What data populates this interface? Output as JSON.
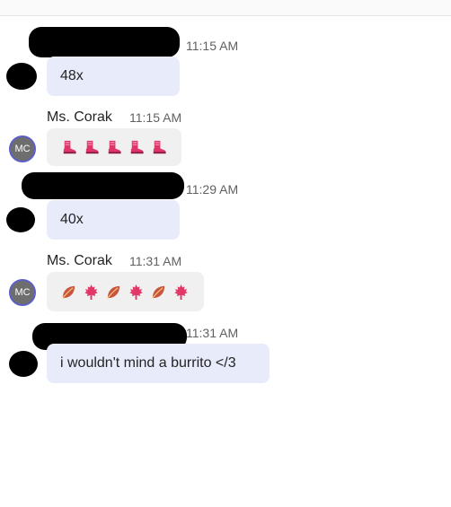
{
  "messages": [
    {
      "id": "m1",
      "time": "11:15 AM",
      "text": "48x"
    },
    {
      "id": "m2",
      "sender": "Ms. Corak",
      "time": "11:15 AM",
      "avatar_initials": "MC",
      "emojis": [
        "boot-icon",
        "boot-icon",
        "boot-icon",
        "boot-icon",
        "boot-icon"
      ]
    },
    {
      "id": "m3",
      "time": "11:29 AM",
      "text": "40x"
    },
    {
      "id": "m4",
      "sender": "Ms. Corak",
      "time": "11:31 AM",
      "avatar_initials": "MC",
      "emojis": [
        "leaf-icon",
        "maple-leaf-icon",
        "leaf-icon",
        "maple-leaf-icon",
        "leaf-icon",
        "maple-leaf-icon"
      ]
    },
    {
      "id": "m5",
      "time": "11:31 AM",
      "text": "i wouldn't mind a burrito </3"
    }
  ],
  "colors": {
    "my_bubble": "#e8ebfa",
    "their_bubble": "#f0f0f0",
    "avatar_border": "#5b5fc7",
    "boot": "#e0356b",
    "leaf": "#c8553d",
    "maple": "#e03868"
  }
}
